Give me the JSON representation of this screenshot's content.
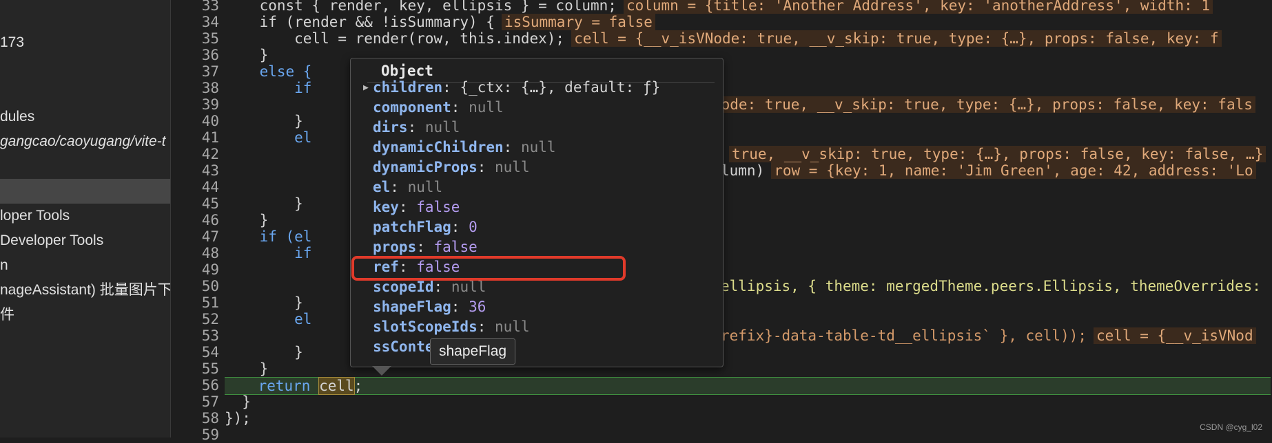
{
  "sidebar": {
    "items": [
      {
        "label": "173"
      },
      {
        "label": "dules"
      },
      {
        "label": "gangcao/caoyugang/vite-t"
      },
      {
        "label": ""
      },
      {
        "label": "loper Tools"
      },
      {
        "label": " Developer Tools"
      },
      {
        "label": "n"
      },
      {
        "label": "nageAssistant) 批量图片下"
      },
      {
        "label": "件"
      }
    ]
  },
  "gutter": {
    "line_numbers": [
      "33",
      "34",
      "35",
      "36",
      "37",
      "38",
      "39",
      "40",
      "41",
      "42",
      "43",
      "44",
      "45",
      "46",
      "47",
      "48",
      "49",
      "50",
      "51",
      "52",
      "53",
      "54",
      "55",
      "56",
      "57",
      "58",
      "59"
    ]
  },
  "code": {
    "l33": {
      "text": "    const { render, key, ellipsis } = column;",
      "inline": "column = {title: 'Another Address', key: 'anotherAddress', width: 1"
    },
    "l34": {
      "text": "    if (render && !isSummary) {",
      "inline": "isSummary = false"
    },
    "l35": {
      "text": "        cell = render(row, this.index);",
      "inline": "cell = {__v_isVNode: true, __v_skip: true, type: {…}, props: false, key: f"
    },
    "l36": {
      "text": "    }"
    },
    "l37": {
      "text": "    else {"
    },
    "l38": {
      "text": "        if"
    },
    "l39": {
      "text": "",
      "inline": "Node: true, __v_skip: true, type: {…}, props: false, key: fals"
    },
    "l40": {
      "text": "        }"
    },
    "l41": {
      "text": "        el"
    },
    "l42": {
      "text": "",
      "inline": "true, __v_skip: true, type: {…}, props: false, key: false, …}"
    },
    "l43": {
      "text": "",
      "tail": "lumn)",
      "inline": "row = {key: 1, name: 'Jim Green', age: 42, address: 'Lo"
    },
    "l44": {
      "text": ""
    },
    "l45": {
      "text": "        }"
    },
    "l46": {
      "text": "    }"
    },
    "l47": {
      "text": "    if (el"
    },
    "l48": {
      "text": "        if"
    },
    "l49": {
      "text": ""
    },
    "l50": {
      "text": "",
      "tail": "ellipsis, { theme: mergedTheme.peers.Ellipsis, themeOverrides:"
    },
    "l51": {
      "text": "        }"
    },
    "l52": {
      "text": "        el"
    },
    "l53": {
      "text": "",
      "tail": "refix}-data-table-td__ellipsis` }, cell));",
      "inline": "cell = {__v_isVNod"
    },
    "l54": {
      "text": "        }"
    },
    "l55": {
      "text": "    }"
    },
    "l56": {
      "text_before": "    return ",
      "word": "cell",
      "text_after": ";"
    },
    "l57": {
      "text": "  }"
    },
    "l58": {
      "text": "});"
    }
  },
  "popover": {
    "title": "Object",
    "rows": [
      {
        "key": "children",
        "value": "{_ctx: {…}, default: ƒ}",
        "type": "obj"
      },
      {
        "key": "component",
        "value": "null",
        "type": "null"
      },
      {
        "key": "dirs",
        "value": "null",
        "type": "null"
      },
      {
        "key": "dynamicChildren",
        "value": "null",
        "type": "null"
      },
      {
        "key": "dynamicProps",
        "value": "null",
        "type": "null"
      },
      {
        "key": "el",
        "value": "null",
        "type": "null"
      },
      {
        "key": "key",
        "value": "false",
        "type": "bool"
      },
      {
        "key": "patchFlag",
        "value": "0",
        "type": "num"
      },
      {
        "key": "props",
        "value": "false",
        "type": "bool"
      },
      {
        "key": "ref",
        "value": "false",
        "type": "bool"
      },
      {
        "key": "scopeId",
        "value": "null",
        "type": "null"
      },
      {
        "key": "shapeFlag",
        "value": "36",
        "type": "num"
      },
      {
        "key": "slotScopeIds",
        "value": "null",
        "type": "null"
      },
      {
        "key": "ssConte",
        "value": "",
        "type": "obj"
      }
    ]
  },
  "tooltip": {
    "label": "shapeFlag"
  },
  "watermark": {
    "text": "CSDN @cyg_l02"
  },
  "colors": {
    "highlight": "#e03a2a",
    "accent": "#8fb6ee"
  }
}
